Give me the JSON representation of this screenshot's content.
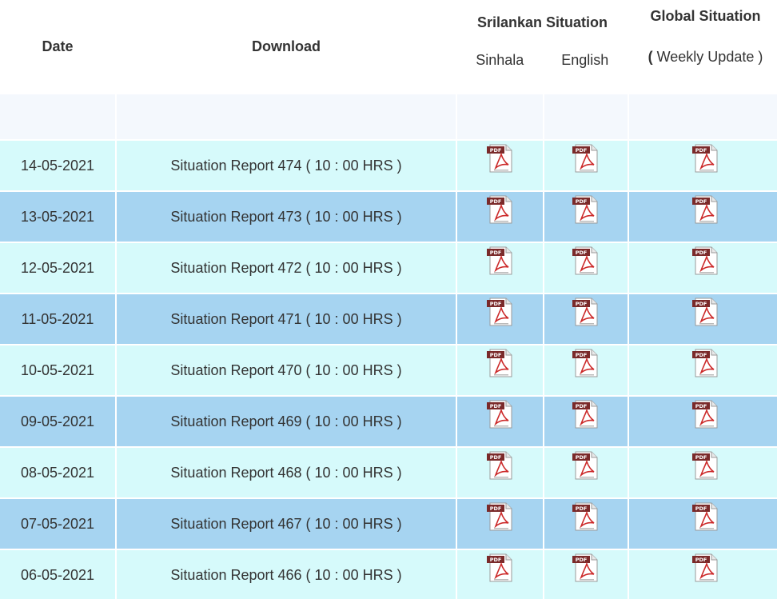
{
  "header": {
    "date": "Date",
    "download": "Download",
    "srilankan": "Srilankan Situation",
    "sinhala": "Sinhala",
    "english": "English",
    "global": "Global Situation",
    "weekly_open": "(",
    "weekly_text": " Weekly Update ",
    "weekly_close": ")"
  },
  "icon_name": "pdf-file-icon",
  "colors": {
    "row_light": "#d6fafb",
    "row_dark": "#a6d4f1",
    "spacer": "#f4f8fd"
  },
  "rows": [
    {
      "date": "14-05-2021",
      "report": "Situation Report 474 ( 10 : 00 HRS )"
    },
    {
      "date": "13-05-2021",
      "report": "Situation Report 473 ( 10 : 00 HRS )"
    },
    {
      "date": "12-05-2021",
      "report": "Situation Report 472 ( 10 : 00 HRS )"
    },
    {
      "date": "11-05-2021",
      "report": "Situation Report 471 ( 10 : 00 HRS )"
    },
    {
      "date": "10-05-2021",
      "report": "Situation Report 470 ( 10 : 00 HRS )"
    },
    {
      "date": "09-05-2021",
      "report": "Situation Report 469 ( 10 : 00 HRS )"
    },
    {
      "date": "08-05-2021",
      "report": "Situation Report 468 ( 10 : 00 HRS )"
    },
    {
      "date": "07-05-2021",
      "report": "Situation Report 467 ( 10 : 00 HRS )"
    },
    {
      "date": "06-05-2021",
      "report": "Situation Report 466 ( 10 : 00 HRS )"
    }
  ]
}
